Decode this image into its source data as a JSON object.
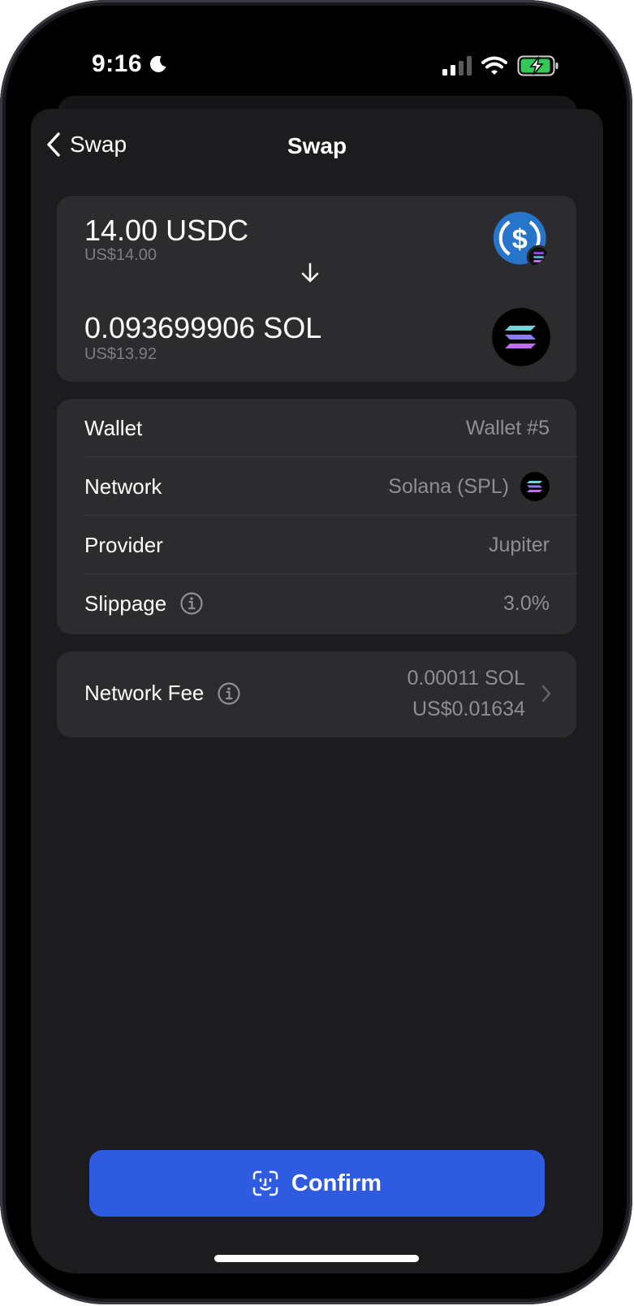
{
  "status_bar": {
    "time": "9:16",
    "icons": [
      "moon-icon",
      "cellular-signal-icon",
      "wifi-icon",
      "battery-charging-icon"
    ]
  },
  "nav": {
    "back_label": "Swap",
    "title": "Swap"
  },
  "swap": {
    "from": {
      "amount": "14.00 USDC",
      "fiat": "US$14.00",
      "icon": "usdc-icon"
    },
    "to": {
      "amount": "0.093699906 SOL",
      "fiat": "US$13.92",
      "icon": "solana-icon"
    }
  },
  "details": {
    "wallet": {
      "label": "Wallet",
      "value": "Wallet #5"
    },
    "network": {
      "label": "Network",
      "value": "Solana (SPL)"
    },
    "provider": {
      "label": "Provider",
      "value": "Jupiter"
    },
    "slippage": {
      "label": "Slippage",
      "value": "3.0%"
    }
  },
  "fee": {
    "label": "Network Fee",
    "amount": "0.00011 SOL",
    "fiat": "US$0.01634"
  },
  "confirm_label": "Confirm",
  "colors": {
    "accent": "#2e5be0",
    "card": "#2c2c2e",
    "sheet": "#1c1c1e",
    "usdc_blue": "#2775ca"
  }
}
